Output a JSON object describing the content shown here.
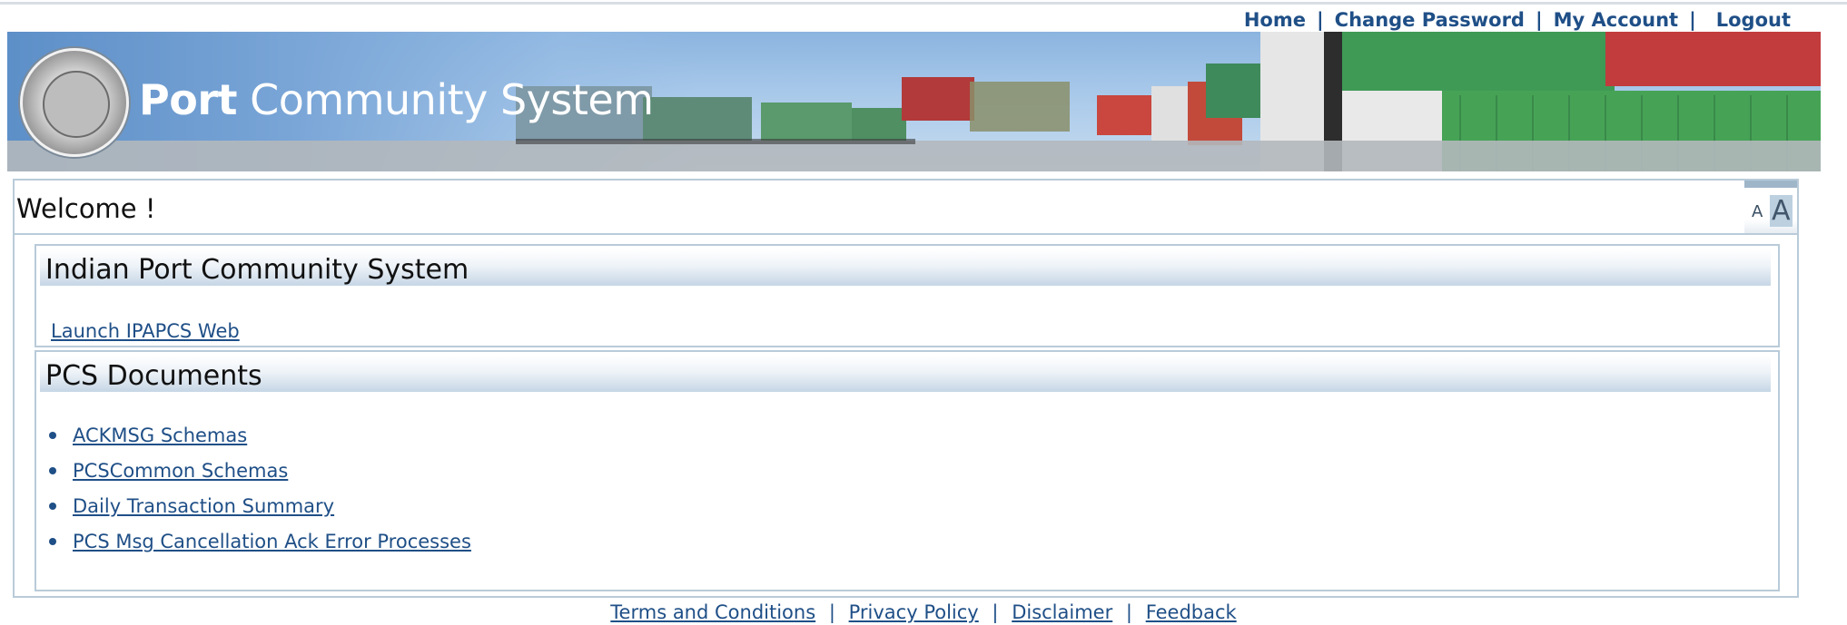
{
  "topnav": {
    "home": "Home",
    "change_password": "Change Password",
    "my_account": "My Account",
    "logout": "Logout",
    "separator": "|"
  },
  "banner": {
    "title_bold": "Port",
    "title_rest": "Community System"
  },
  "welcome": {
    "text": "Welcome !",
    "font_small": "A",
    "font_large": "A"
  },
  "sections": {
    "ipcs": {
      "title": "Indian Port Community System",
      "launch_link": "Launch IPAPCS Web"
    },
    "documents": {
      "title": "PCS Documents",
      "items": [
        "ACKMSG Schemas",
        "PCSCommon Schemas",
        "Daily Transaction Summary",
        "PCS Msg Cancellation Ack Error Processes"
      ]
    }
  },
  "footer": {
    "terms": "Terms and Conditions",
    "privacy": "Privacy Policy",
    "disclaimer": "Disclaimer",
    "feedback": "Feedback",
    "separator": "|"
  },
  "colors": {
    "link": "#1f4f87",
    "border": "#b9cbd9",
    "header_gradient_end": "#c6d6e5"
  }
}
